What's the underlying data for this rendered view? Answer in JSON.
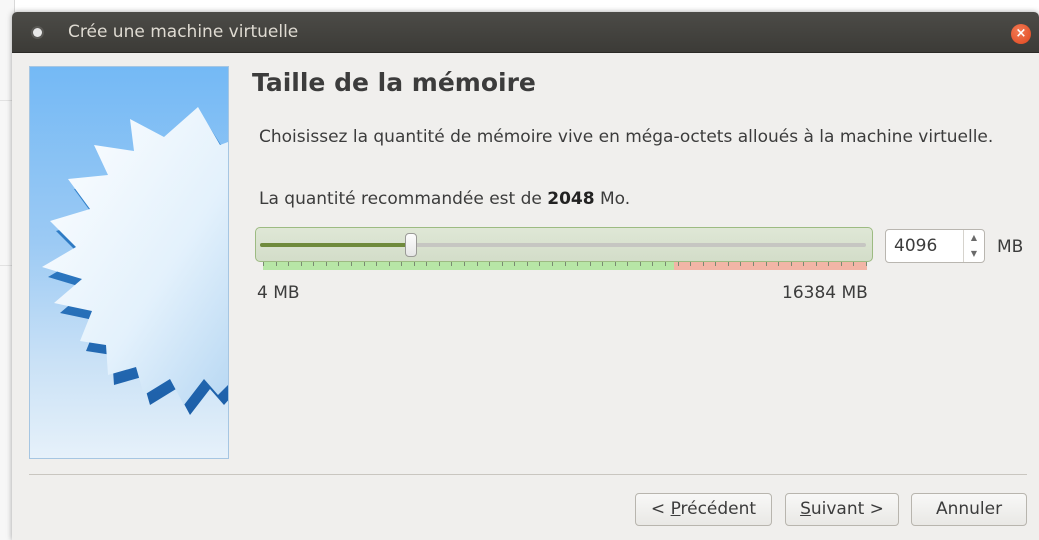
{
  "window": {
    "title": "Crée une machine virtuelle",
    "close_label": "×"
  },
  "page": {
    "heading": "Taille de la mémoire",
    "description": "Choisissez la quantité de mémoire vive en méga-octets alloués à la machine virtuelle.",
    "recommendation": {
      "prefix": "La quantité recommandée est de ",
      "value": "2048",
      "suffix": " Mo."
    }
  },
  "memory": {
    "value": "4096",
    "unit": "MB",
    "min_label": "4 MB",
    "max_label": "16384 MB",
    "min_mb": 4,
    "max_mb": 16384,
    "current_mb": 4096,
    "safe_limit_fraction": 0.68
  },
  "buttons": {
    "previous": {
      "accel": "P",
      "rest": "récédent",
      "prefix": "< "
    },
    "next": {
      "accel": "S",
      "rest": "uivant >"
    },
    "cancel": "Annuler"
  },
  "colors": {
    "slider_fill": "#6f8a3c",
    "scale_safe": "#b7e6a6",
    "scale_danger": "#f2b5a6",
    "close_button": "#e0461e"
  },
  "icons": {
    "close": "close-icon",
    "window_menu": "window-menu-dot-icon",
    "wizard_art": "starburst-icon"
  }
}
